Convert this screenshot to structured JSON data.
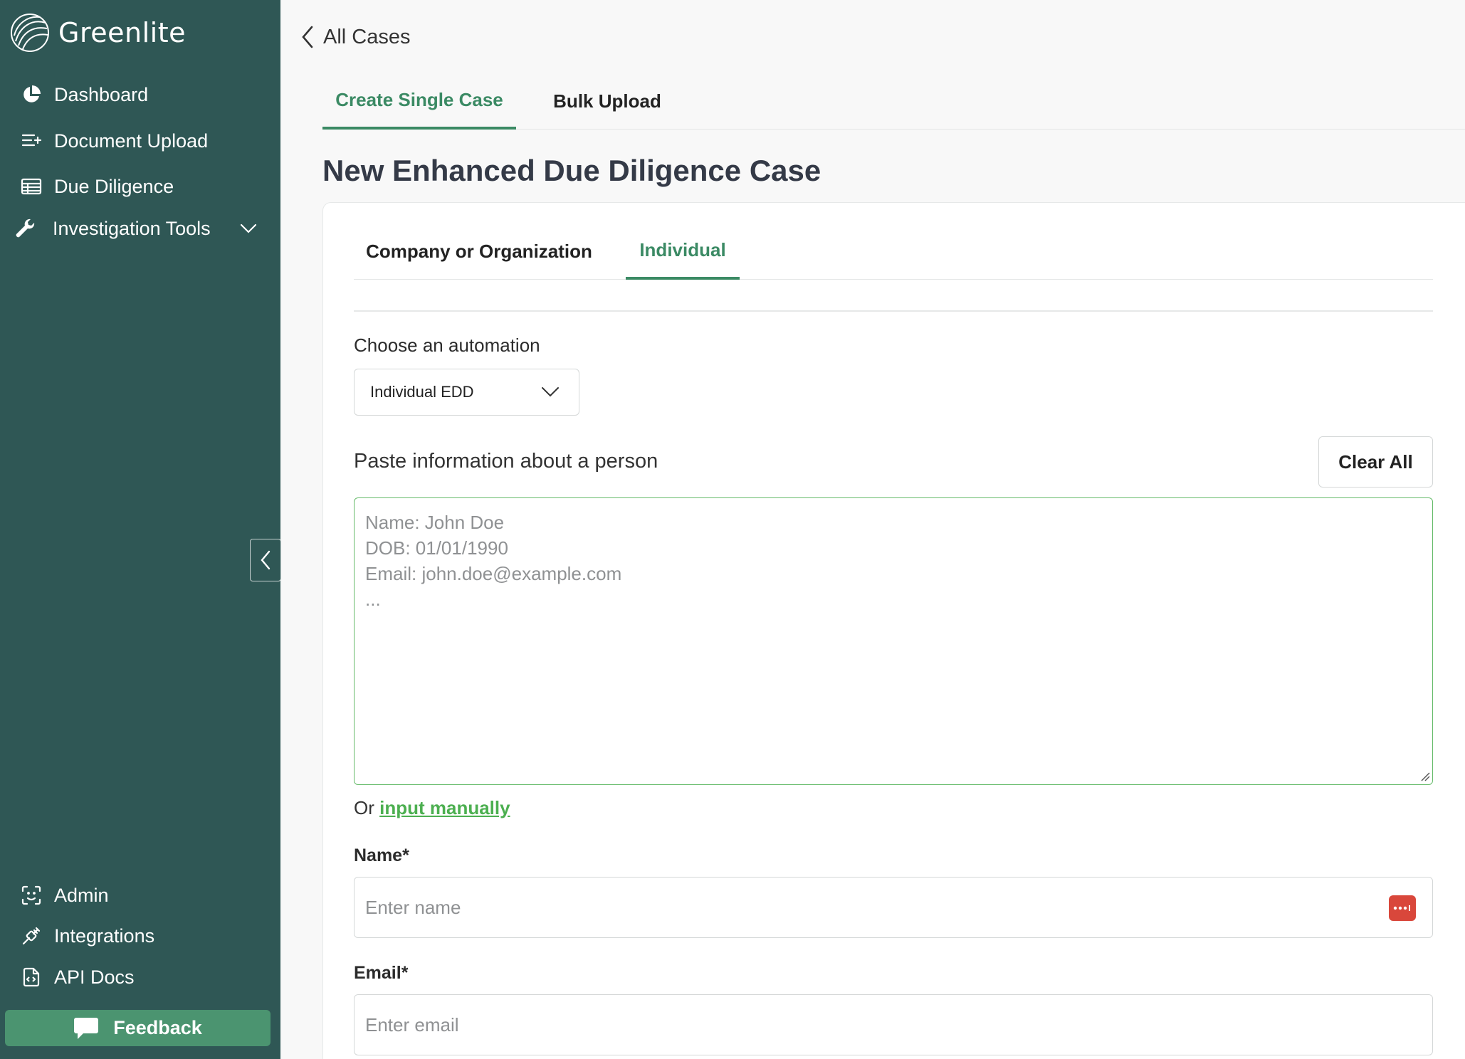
{
  "app": {
    "name": "Greenlite",
    "accent": "#3b8a64",
    "sidebar_bg": "#2f5755"
  },
  "sidebar": {
    "items": [
      {
        "label": "Dashboard",
        "icon": "pie-chart-icon"
      },
      {
        "label": "Document Upload",
        "icon": "list-add-icon"
      },
      {
        "label": "Due Diligence",
        "icon": "table-icon"
      },
      {
        "label": "Investigation Tools",
        "icon": "wrench-icon"
      }
    ],
    "bottom_items": [
      {
        "label": "Admin",
        "icon": "face-scan-icon"
      },
      {
        "label": "Integrations",
        "icon": "plug-icon"
      },
      {
        "label": "API Docs",
        "icon": "document-code-icon"
      }
    ],
    "feedback_label": "Feedback"
  },
  "back_link": "All Cases",
  "top_tabs": [
    {
      "label": "Create Single Case",
      "active": true
    },
    {
      "label": "Bulk Upload",
      "active": false
    }
  ],
  "page_title": "New Enhanced Due Diligence Case",
  "entity_tabs": [
    {
      "label": "Company or Organization",
      "active": false
    },
    {
      "label": "Individual",
      "active": true
    }
  ],
  "automation": {
    "label": "Choose an automation",
    "selected": "Individual EDD"
  },
  "paste": {
    "label": "Paste information about a person",
    "clear_label": "Clear All",
    "placeholder_lines": [
      "Name: John Doe",
      "DOB: 01/01/1990",
      "Email: john.doe@example.com",
      "..."
    ]
  },
  "manual": {
    "prefix": "Or ",
    "link": "input manually"
  },
  "fields": {
    "name_label": "Name*",
    "name_placeholder": "Enter name",
    "email_label": "Email*",
    "email_placeholder": "Enter email"
  }
}
